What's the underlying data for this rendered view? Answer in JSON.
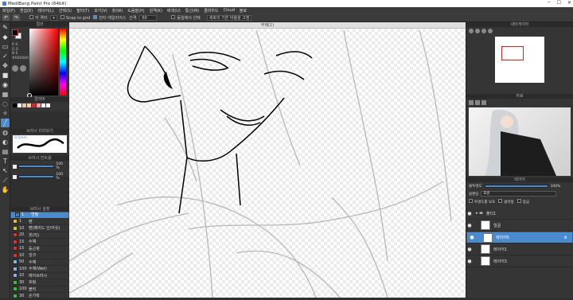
{
  "app": {
    "title": "MediBang Paint Pro (64bit)"
  },
  "menu": [
    "파일(F)",
    "편집(E)",
    "레이어(L)",
    "선택(S)",
    "필터(T)",
    "보기(V)",
    "창(W)",
    "도움말(H)",
    "원격(K)",
    "배색(U)",
    "통신(M)",
    "클라우드",
    "Cloud",
    "블로"
  ],
  "toolbar": {
    "grid_label": "각 격자",
    "snap_label": "Snap to grid",
    "antialias_label": "안티 에일리어스",
    "interval_label": "간격",
    "interval_value": "60",
    "reference_label": "동일에서 선택",
    "protect_label": "세로의 기본 비율을 고정"
  },
  "left": {
    "color_header": "컬러",
    "hue_label": "H",
    "color_values": [
      "R 0",
      "G 0",
      "B 0",
      "#000000"
    ],
    "palette_header": "컬러바",
    "preview_header": "브러시 미리보기",
    "preview_size": "0.5mm",
    "brush_ctrl_header": "브러시 컨트롤",
    "size_value": "100 %",
    "opacity_value": "100 %",
    "brush_list_header": "브러시 설정",
    "brushes": [
      {
        "num": "1",
        "name": "연필",
        "color": "#3c7fc2",
        "selected": true
      },
      {
        "num": "1",
        "name": "펜",
        "color": "#e0c020",
        "selected": false
      },
      {
        "num": "10",
        "name": "펜(페이드 인/아웃)",
        "color": "#e0c020",
        "selected": false
      },
      {
        "num": "20",
        "name": "붓(직)",
        "color": "#e03030",
        "selected": false
      },
      {
        "num": "15",
        "name": "수채",
        "color": "#e03030",
        "selected": false
      },
      {
        "num": "15",
        "name": "둥근붓",
        "color": "#e03030",
        "selected": false
      },
      {
        "num": "10",
        "name": "잉크",
        "color": "#e03030",
        "selected": false
      },
      {
        "num": "50",
        "name": "수채",
        "color": "#8ab0e8",
        "selected": false
      },
      {
        "num": "100",
        "name": "수채(Wet)",
        "color": "#8ab0e8",
        "selected": false
      },
      {
        "num": "10",
        "name": "에어브러시",
        "color": "#8ab0e8",
        "selected": false
      },
      {
        "num": "30",
        "name": "흐림",
        "color": "#3cba3c",
        "selected": false
      },
      {
        "num": "100",
        "name": "블러",
        "color": "#3cba3c",
        "selected": false
      },
      {
        "num": "30",
        "name": "손가락",
        "color": "#3cba3c",
        "selected": false
      }
    ]
  },
  "canvas": {
    "title": "무제(1)"
  },
  "right": {
    "navigator_header": "내비게이터",
    "reference_header": "자료",
    "layer_header": "레이어",
    "opacity_label": "불투명도",
    "opacity_value": "100%",
    "blend_label": "블렌딩",
    "blend_value": "표준",
    "protect_alpha": "투명도를 보호",
    "clipping": "클리핑",
    "lock": "잠금",
    "layers": [
      {
        "name": "폴더1",
        "type": "folder",
        "selected": false
      },
      {
        "name": "얼굴",
        "type": "layer",
        "selected": false
      },
      {
        "name": "레이어5",
        "type": "layer",
        "selected": true
      },
      {
        "name": "레이어1",
        "type": "layer",
        "selected": false
      },
      {
        "name": "레이어3",
        "type": "layer",
        "selected": false
      }
    ]
  },
  "colors": {
    "accent": "#4a8bd0",
    "fg": "#000000",
    "bg": "#ffffff"
  }
}
